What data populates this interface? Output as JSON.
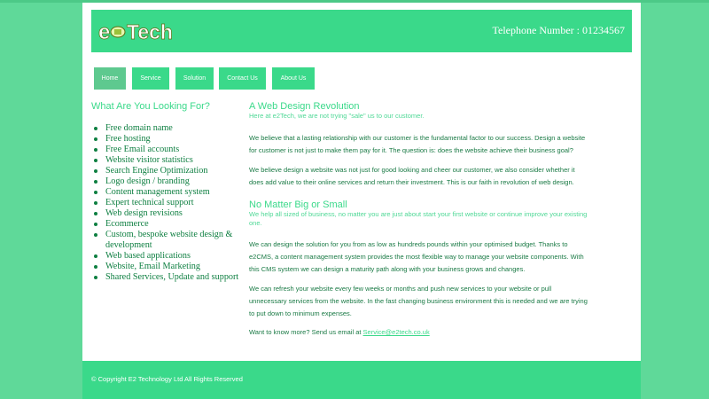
{
  "brand": {
    "logo_text": "e2Tech",
    "colors": {
      "primary": "#3ad98a",
      "background": "#5fd999",
      "text_green": "#0e7f41"
    }
  },
  "header": {
    "phone": "Telephone Number : 01234567"
  },
  "nav": {
    "items": [
      {
        "label": "Home",
        "active": true
      },
      {
        "label": "Service"
      },
      {
        "label": "Solution"
      },
      {
        "label": "Contact Us"
      },
      {
        "label": "About Us"
      }
    ]
  },
  "sidebar": {
    "title": "What Are You Looking For?",
    "items": [
      "Free domain name",
      "Free hosting",
      "Free Email accounts",
      "Website visitor statistics",
      "Search Engine Optimization",
      "Logo design / branding",
      "Content management system",
      "Expert technical support",
      "Web design revisions",
      "Ecommerce",
      "Custom, bespoke website design & development",
      "Web based applications",
      "Website, Email Marketing",
      "Shared Services, Update and support"
    ]
  },
  "main": {
    "section1": {
      "title": "A Web Design Revolution",
      "subtitle": "Here at e2Tech, we are not trying \"sale\" us to our customer.",
      "p1": "We believe that a lasting relationship with our customer is the fundamental factor to our success. Design a website for customer is not just to make them pay for it. The question is: does the website achieve their business goal?",
      "p2": "We believe design a website was not just for good looking and cheer our customer, we also consider whether it does add value to their online services and return their investment. This is our faith in revolution of web design."
    },
    "section2": {
      "title": "No Matter Big or Small",
      "subtitle": "We help all sized of business, no matter you are just about start your first website or continue improve your existing one.",
      "p1": "We can design the solution for you from as low as hundreds pounds within your optimised budget. Thanks to e2CMS, a content management system provides the most flexible way to manage your website components. With this CMS system we can design a maturity path along with your business grows and changes.",
      "p2": "We can refresh your website every few weeks or months and push new services to your website or pull unnecessary services from the website. In the fast changing business environment this is needed and we are trying to put down to minimum expenses.",
      "contact_text": "Want to know more? Send us email at ",
      "email": "Service@e2tech.co.uk"
    }
  },
  "footer": {
    "copyright": "© Copyright E2 Technology Ltd All Rights Reserved"
  }
}
